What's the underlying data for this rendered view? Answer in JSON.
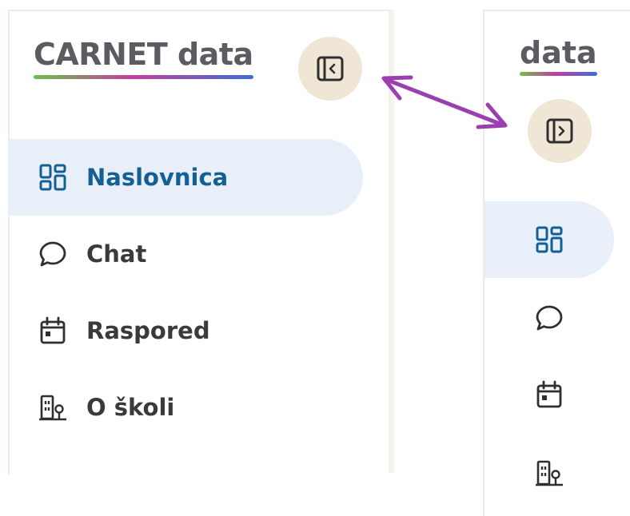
{
  "brand": {
    "logo_text": "CARNET data",
    "logo_text_collapsed": "data"
  },
  "sidebar_expanded": {
    "toggle_icon": "sidebar-collapse-icon",
    "items": [
      {
        "label": "Naslovnica",
        "icon": "dashboard-icon",
        "active": true
      },
      {
        "label": "Chat",
        "icon": "chat-bubble-icon",
        "active": false
      },
      {
        "label": "Raspored",
        "icon": "calendar-icon",
        "active": false
      },
      {
        "label": "O školi",
        "icon": "school-building-icon",
        "active": false
      }
    ]
  },
  "sidebar_collapsed": {
    "toggle_icon": "sidebar-expand-icon",
    "items": [
      {
        "icon": "dashboard-icon",
        "active": true
      },
      {
        "icon": "chat-bubble-icon",
        "active": false
      },
      {
        "icon": "calendar-icon",
        "active": false
      },
      {
        "icon": "school-building-icon",
        "active": false
      }
    ]
  },
  "annotation": {
    "icon": "double-headed-arrow-icon",
    "color": "#9b3fb0"
  },
  "colors": {
    "active_text": "#145f93",
    "active_bg": "#e8eff8",
    "toggle_bg": "#efe6d6",
    "text": "#3a3a3d"
  }
}
